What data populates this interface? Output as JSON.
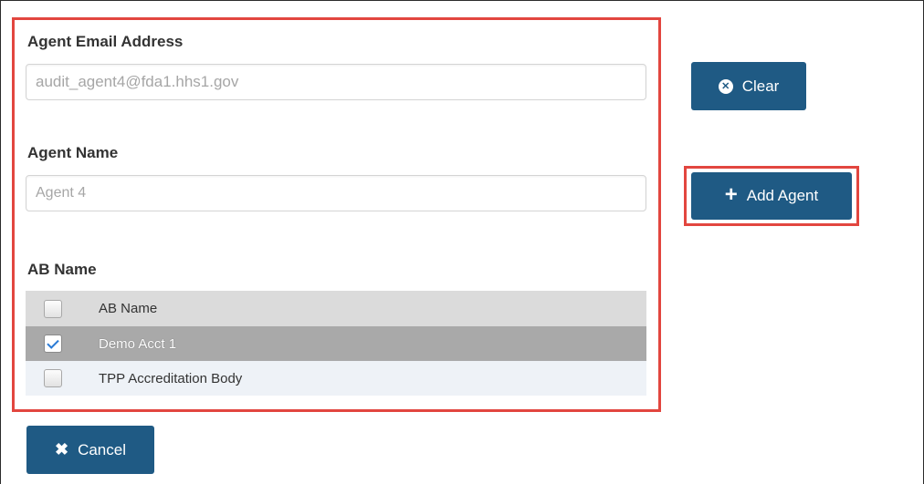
{
  "form": {
    "email_label": "Agent Email Address",
    "email_value": "audit_agent4@fda1.hhs1.gov",
    "name_label": "Agent Name",
    "name_value": "Agent 4",
    "ab_label": "AB Name"
  },
  "ab_table": {
    "header": "AB Name",
    "rows": [
      {
        "name": "Demo Acct 1",
        "checked": true
      },
      {
        "name": "TPP Accreditation Body",
        "checked": false
      }
    ]
  },
  "buttons": {
    "clear_label": "Clear",
    "add_agent_label": "Add Agent",
    "cancel_label": "Cancel"
  },
  "icons": {
    "clear": "times-circle-icon",
    "add": "plus-icon",
    "cancel": "times-icon"
  },
  "colors": {
    "button_bg": "#1f5a84",
    "highlight": "#e2463f",
    "selected_row": "#a9a9a9",
    "header_row": "#dbdbdb",
    "alt_row": "#eef2f7"
  }
}
